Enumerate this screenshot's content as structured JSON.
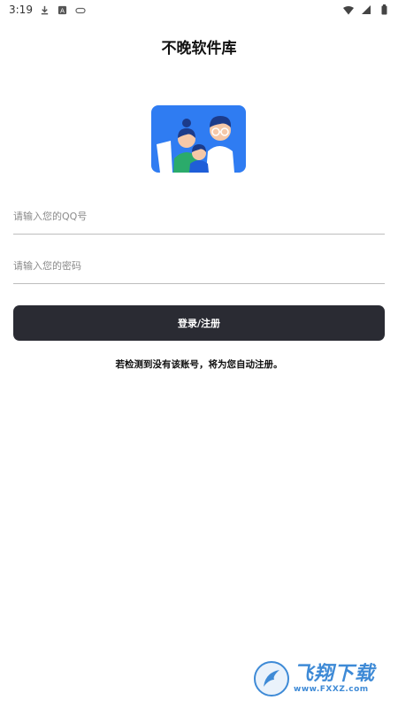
{
  "status_bar": {
    "time": "3:19",
    "left_icons": [
      "download-icon",
      "font-icon",
      "gamepad-icon"
    ],
    "right_icons": [
      "wifi-icon",
      "signal-icon",
      "battery-icon"
    ]
  },
  "app": {
    "title": "不晚软件库"
  },
  "form": {
    "qq_placeholder": "请输入您的QQ号",
    "qq_value": "",
    "password_placeholder": "请输入您的密码",
    "password_value": "",
    "submit_label": "登录/注册",
    "hint": "若检测到没有该账号，将为您自动注册。"
  },
  "colors": {
    "button_bg": "#2a2b33",
    "logo_bg": "#2f7cf2",
    "watermark": "#3e8ad6"
  },
  "watermark": {
    "brand": "飞翔下载",
    "url": "www.FXXZ.com"
  }
}
